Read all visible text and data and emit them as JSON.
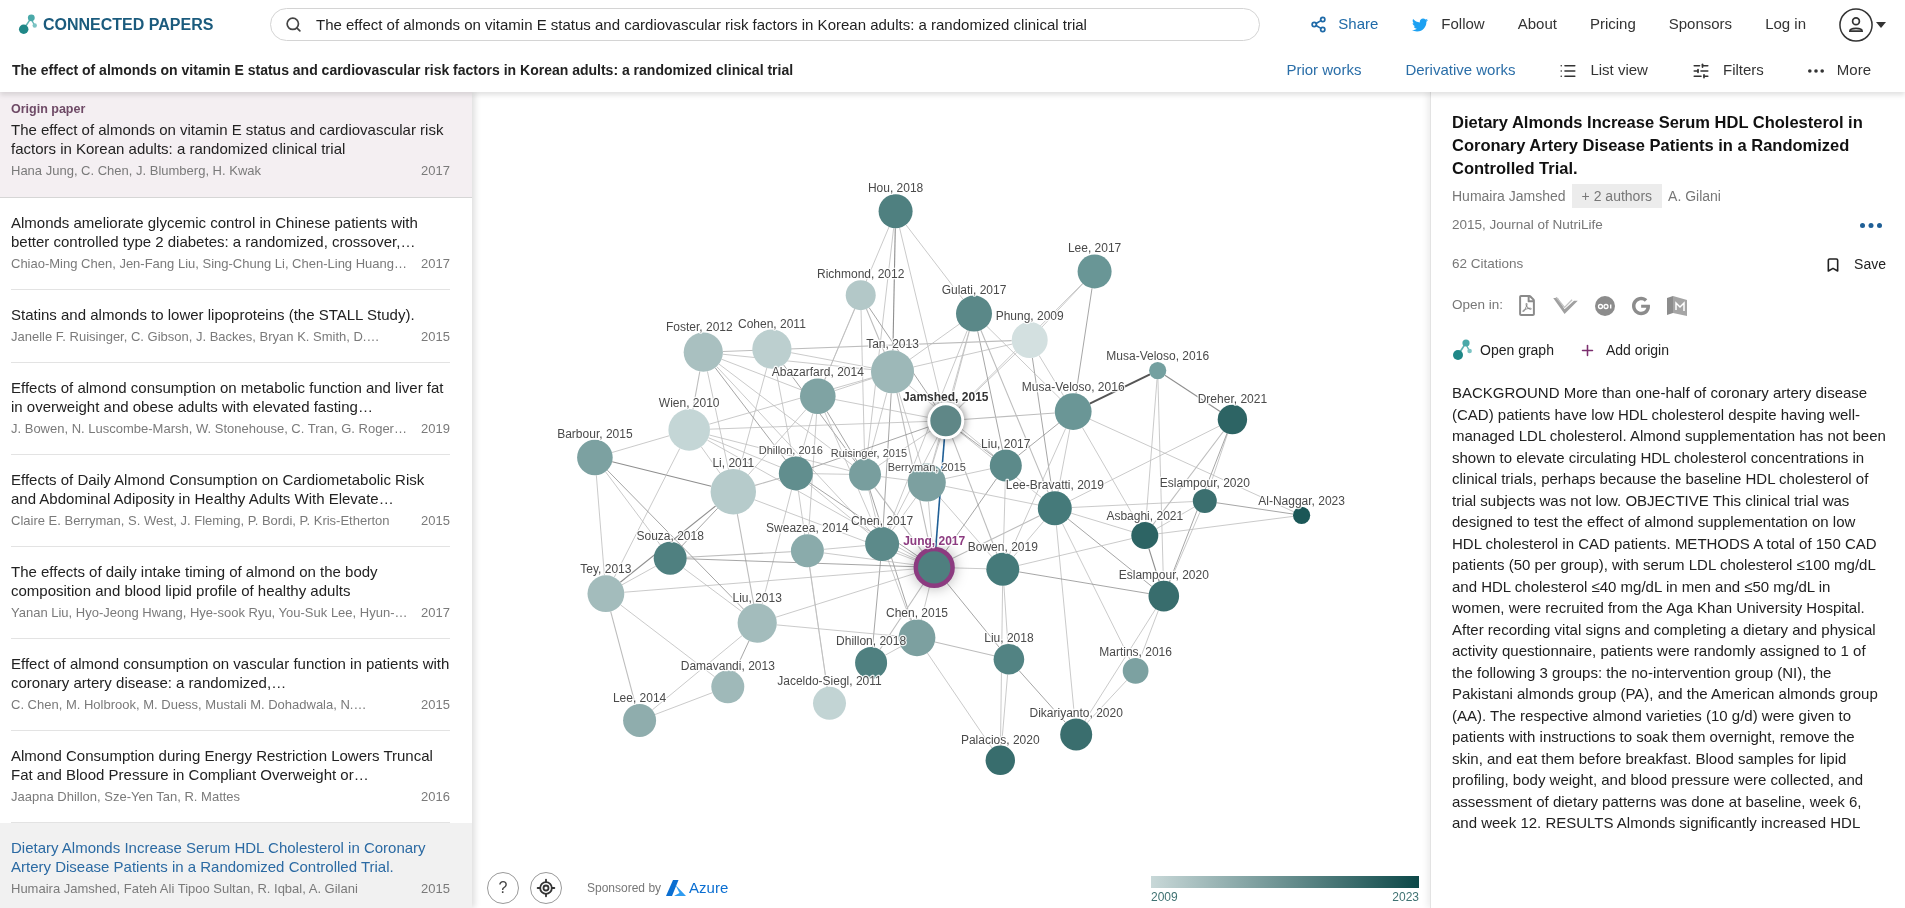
{
  "header": {
    "logo": "CONNECTED PAPERS",
    "search": {
      "value": "The effect of almonds on vitamin E status and cardiovascular risk factors in Korean adults: a randomized clinical trial"
    },
    "nav": [
      {
        "kind": "share",
        "label": "Share"
      },
      {
        "kind": "follow",
        "label": "Follow"
      },
      {
        "kind": "link",
        "label": "About"
      },
      {
        "kind": "link",
        "label": "Pricing"
      },
      {
        "kind": "link",
        "label": "Sponsors"
      },
      {
        "kind": "link",
        "label": "Log in"
      }
    ]
  },
  "toolbar": {
    "title": "The effect of almonds on vitamin E status and cardiovascular risk factors in Korean adults: a randomized clinical trial",
    "links": [
      {
        "label": "Prior works"
      },
      {
        "label": "Derivative works"
      }
    ],
    "actions": [
      {
        "kind": "list",
        "label": "List view"
      },
      {
        "kind": "filters",
        "label": "Filters"
      },
      {
        "kind": "more",
        "label": "More"
      }
    ]
  },
  "origin_paper": {
    "label": "Origin paper",
    "title": "The effect of almonds on vitamin E status and cardiovascular risk factors in Korean adults: a randomized clinical trial",
    "authors": "Hana Jung, C. Chen, J. Blumberg, H. Kwak",
    "year": "2017"
  },
  "papers": [
    {
      "title": "Almonds ameliorate glycemic control in Chinese patients with better controlled type 2 diabetes: a randomized, crossover,…",
      "authors": "Chiao-Ming Chen, Jen-Fang Liu, Sing-Chung Li, Chen-Ling Huang…",
      "year": "2017",
      "selected": false
    },
    {
      "title": "Statins and almonds to lower lipoproteins (the STALL Study).",
      "authors": "Janelle F. Ruisinger, C. Gibson, J. Backes, Bryan K. Smith, D.…",
      "year": "2015",
      "selected": false
    },
    {
      "title": "Effects of almond consumption on metabolic function and liver fat in overweight and obese adults with elevated fasting…",
      "authors": "J. Bowen, N. Luscombe-Marsh, W. Stonehouse, C. Tran, G. Roger…",
      "year": "2019",
      "selected": false
    },
    {
      "title": "Effects of Daily Almond Consumption on Cardiometabolic Risk and Abdominal Adiposity in Healthy Adults With Elevate…",
      "authors": "Claire E. Berryman, S. West, J. Fleming, P. Bordi, P. Kris-Etherton",
      "year": "2015",
      "selected": false
    },
    {
      "title": "The effects of daily intake timing of almond on the body composition and blood lipid profile of healthy adults",
      "authors": "Yanan Liu, Hyo-Jeong Hwang, Hye-sook Ryu, You-Suk Lee, Hyun-…",
      "year": "2017",
      "selected": false
    },
    {
      "title": "Effect of almond consumption on vascular function in patients with coronary artery disease: a randomized,…",
      "authors": "C. Chen, M. Holbrook, M. Duess, Mustali M. Dohadwala, N.…",
      "year": "2015",
      "selected": false
    },
    {
      "title": "Almond Consumption during Energy Restriction Lowers Truncal Fat and Blood Pressure in Compliant Overweight or…",
      "authors": "Jaapna Dhillon, Sze-Yen Tan, R. Mattes",
      "year": "2016",
      "selected": false
    },
    {
      "title": "Dietary Almonds Increase Serum HDL Cholesterol in Coronary Artery Disease Patients in a Randomized Controlled Trial.",
      "authors": "Humaira Jamshed, Fateh Ali Tipoo Sultan, R. Iqbal, A. Gilani",
      "year": "2015",
      "selected": true
    }
  ],
  "graph": {
    "nodes": [
      {
        "label": "Hou, 2018",
        "color": "#4f8080",
        "kind": "paper",
        "selected": false
      },
      {
        "label": "Lee, 2017",
        "color": "#699696",
        "kind": "paper",
        "selected": false
      },
      {
        "label": "Richmond, 2012",
        "color": "#b3c8c8",
        "kind": "paper",
        "selected": false
      },
      {
        "label": "Gulati, 2017",
        "color": "#5a8888",
        "kind": "paper",
        "selected": false
      },
      {
        "label": "Foster, 2012",
        "color": "#a9c0c0",
        "kind": "paper",
        "selected": false
      },
      {
        "label": "Cohen, 2011",
        "color": "#bccfcf",
        "kind": "paper",
        "selected": false
      },
      {
        "label": "Phung, 2009",
        "color": "#d3e0e0",
        "kind": "paper",
        "selected": false
      },
      {
        "label": "Tan, 2013",
        "color": "#9db8b8",
        "kind": "paper",
        "selected": false
      },
      {
        "label": "Musa-Veloso, 2016",
        "color": "#74a0a0",
        "kind": "paper",
        "selected": false
      },
      {
        "label": "Abazarfard, 2014",
        "color": "#7fa3a3",
        "kind": "paper",
        "selected": false
      },
      {
        "label": "Wien, 2010",
        "color": "#c4d6d6",
        "kind": "paper",
        "selected": false
      },
      {
        "label": "Jamshed, 2015",
        "color": "#5f8787",
        "kind": "paper",
        "selected": true
      },
      {
        "label": "Musa-Veloso, 2016",
        "color": "#6a9696",
        "kind": "paper",
        "selected": false
      },
      {
        "label": "Dreher, 2021",
        "color": "#2d6464",
        "kind": "paper",
        "selected": false
      },
      {
        "label": "Barbour, 2015",
        "color": "#7ca1a1",
        "kind": "paper",
        "selected": false
      },
      {
        "label": "Li, 2011",
        "color": "#b6cbcb",
        "kind": "paper",
        "selected": false
      },
      {
        "label": "Dhillon, 2016",
        "color": "#618e8e",
        "kind": "paper",
        "selected": false
      },
      {
        "label": "Ruisinger, 2015",
        "color": "#789e9e",
        "kind": "paper",
        "selected": false
      },
      {
        "label": "Berryman, 2015",
        "color": "#7ca0a0",
        "kind": "paper",
        "selected": false
      },
      {
        "label": "Liu, 2017",
        "color": "#5c8a8a",
        "kind": "paper",
        "selected": false
      },
      {
        "label": "Lee-Bravatti, 2019",
        "color": "#457a7a",
        "kind": "paper",
        "selected": false
      },
      {
        "label": "Eslampour, 2020",
        "color": "#3b6f6f",
        "kind": "paper",
        "selected": false
      },
      {
        "label": "Al-Naggar, 2023",
        "color": "#1b5757",
        "kind": "paper",
        "selected": false
      },
      {
        "label": "Souza, 2018",
        "color": "#4f8080",
        "kind": "paper",
        "selected": false
      },
      {
        "label": "Sweazea, 2014",
        "color": "#8aabab",
        "kind": "paper",
        "selected": false
      },
      {
        "label": "Chen, 2017",
        "color": "#5c8a8a",
        "kind": "paper",
        "selected": false
      },
      {
        "label": "Jung, 2017",
        "color": "#4f7f7f",
        "kind": "origin",
        "selected": false
      },
      {
        "label": "Bowen, 2019",
        "color": "#457a7a",
        "kind": "paper",
        "selected": false
      },
      {
        "label": "Asbaghi, 2021",
        "color": "#2d6464",
        "kind": "paper",
        "selected": false
      },
      {
        "label": "Tey, 2013",
        "color": "#a3bcbc",
        "kind": "paper",
        "selected": false
      },
      {
        "label": "Eslampour, 2020",
        "color": "#386d6d",
        "kind": "paper",
        "selected": false
      },
      {
        "label": "Liu, 2013",
        "color": "#a3bcbc",
        "kind": "paper",
        "selected": false
      },
      {
        "label": "Chen, 2015",
        "color": "#7ca0a0",
        "kind": "paper",
        "selected": false
      },
      {
        "label": "Dhillon, 2018",
        "color": "#4f8080",
        "kind": "paper",
        "selected": false
      },
      {
        "label": "Liu, 2018",
        "color": "#528383",
        "kind": "paper",
        "selected": false
      },
      {
        "label": "Martins, 2016",
        "color": "#7ca1a1",
        "kind": "paper",
        "selected": false
      },
      {
        "label": "Damavandi, 2013",
        "color": "#9fb9b9",
        "kind": "paper",
        "selected": false
      },
      {
        "label": "Jaceldo-Siegl, 2011",
        "color": "#c2d4d4",
        "kind": "paper",
        "selected": false
      },
      {
        "label": "Lee, 2014",
        "color": "#8fadad",
        "kind": "paper",
        "selected": false
      },
      {
        "label": "Dikariyanto, 2020",
        "color": "#3a6e6e",
        "kind": "paper",
        "selected": false
      },
      {
        "label": "Palacios, 2020",
        "color": "#386d6d",
        "kind": "paper",
        "selected": false
      }
    ],
    "help": "?",
    "sponsor": {
      "label": "Sponsored by",
      "brand": "Azure"
    },
    "legend": {
      "start": "2009",
      "end": "2023"
    }
  },
  "detail": {
    "title": "Dietary Almonds Increase Serum HDL Cholesterol in Coronary Artery Disease Patients in a Randomized Controlled Trial.",
    "authors": [
      {
        "kind": "name",
        "text": "Humaira Jamshed"
      },
      {
        "kind": "more",
        "text": "+ 2 authors"
      },
      {
        "kind": "name",
        "text": "A. Gilani"
      }
    ],
    "meta": "2015, Journal of NutriLife",
    "citations": "62 Citations",
    "save": "Save",
    "open_in": "Open in:",
    "actions": [
      {
        "kind": "graph",
        "label": "Open graph"
      },
      {
        "kind": "add",
        "label": "Add origin"
      }
    ],
    "abstract": "BACKGROUND More than one-half of coronary artery disease (CAD) patients have low HDL cholesterol despite having well-managed LDL cholesterol. Almond supplementation has not been shown to elevate circulating HDL cholesterol concentrations in clinical trials, perhaps because the baseline HDL cholesterol of trial subjects was not low. OBJECTIVE This clinical trial was designed to test the effect of almond supplementation on low HDL cholesterol in CAD patients. METHODS A total of 150 CAD patients (50 per group), with serum LDL cholesterol ≤100 mg/dL and HDL cholesterol ≤40 mg/dL in men and ≤50 mg/dL in women, were recruited from the Aga Khan University Hospital. After recording vital signs and completing a dietary and physical activity questionnaire, patients were randomly assigned to 1 of the following 3 groups: the no-intervention group (NI), the Pakistani almonds group (PA), and the American almonds group (AA). The respective almond varieties (10 g/d) were given to patients with instructions to soak them overnight, remove the skin, and eat them before breakfast. Blood samples for lipid profiling, body weight, and blood pressure were collected, and assessment of dietary patterns was done at baseline, week 6, and week 12. RESULTS Almonds significantly increased HDL"
  }
}
